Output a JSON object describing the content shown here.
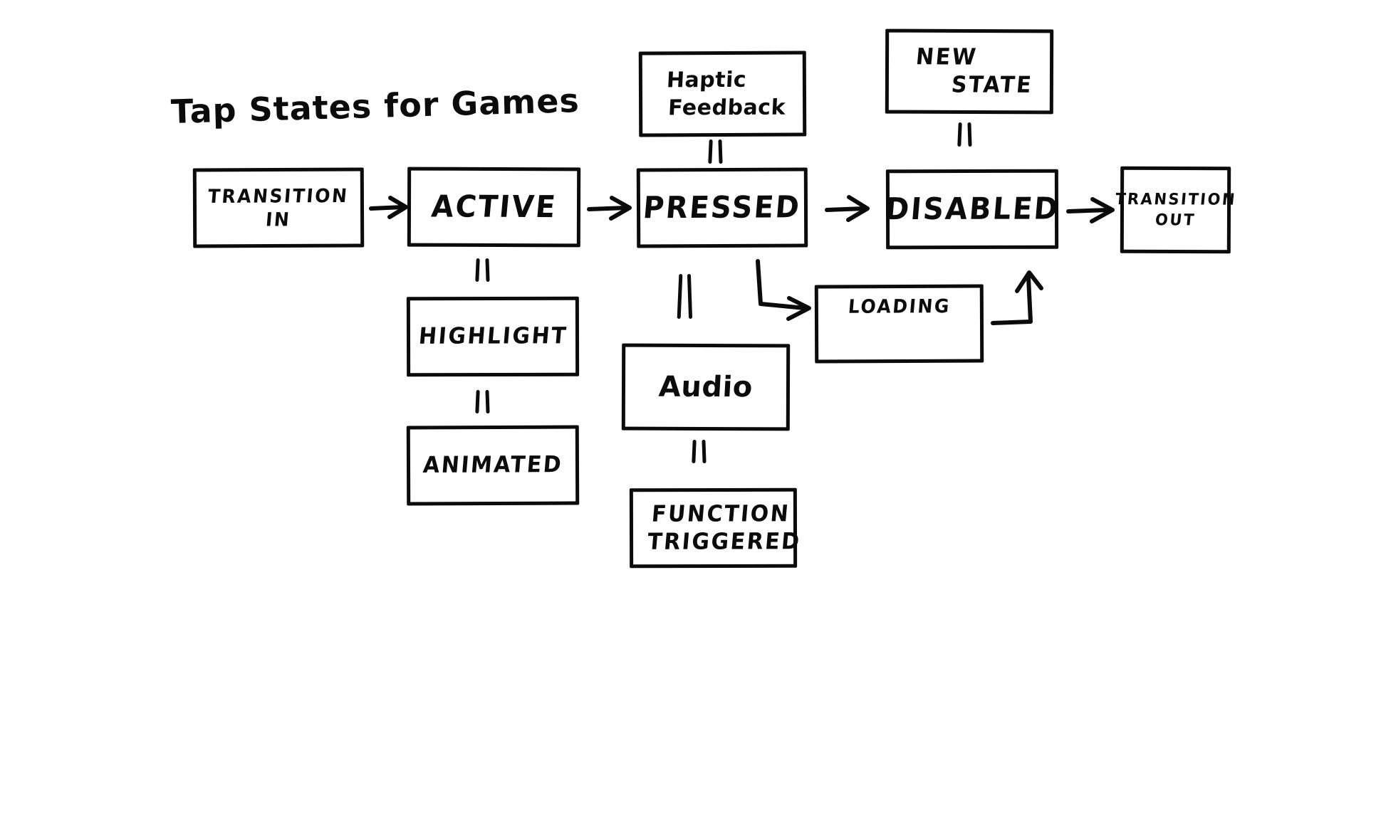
{
  "diagram": {
    "title": "Tap States for Games",
    "style": "hand-drawn whiteboard sketch",
    "ink_color": "#0b0b0b",
    "background_color": "#ffffff"
  },
  "nodes": {
    "transition_in": {
      "line1": "TRANSITION",
      "line2": "IN"
    },
    "active": {
      "line1": "ACTIVE"
    },
    "pressed": {
      "line1": "PRESSED"
    },
    "disabled": {
      "line1": "DISABLED"
    },
    "transition_out": {
      "line1": "TRANSITION",
      "line2": "OUT"
    },
    "haptic_feedback": {
      "line1": "Haptic",
      "line2": "Feedback"
    },
    "new_state": {
      "line1": "NEW",
      "line2": "STATE"
    },
    "highlight": {
      "line1": "HIGHLIGHT"
    },
    "animated": {
      "line1": "ANIMATED"
    },
    "audio": {
      "line1": "Audio"
    },
    "function_triggered": {
      "line1": "FUNCTION",
      "line2": "TRIGGERED"
    },
    "loading": {
      "line1": "LOADING",
      "icon": "spinner-icon"
    }
  },
  "connectors": {
    "arrow_transition_in_to_active": "arrow-right",
    "arrow_active_to_pressed": "arrow-right",
    "arrow_pressed_to_disabled": "arrow-right",
    "arrow_disabled_to_transition_out": "arrow-right",
    "elbow_pressed_to_loading": "elbow-arrow-down-right",
    "elbow_loading_to_disabled": "elbow-arrow-right-up",
    "pipes_haptic_to_pressed": "double-pipe",
    "pipes_new_state_to_disabled": "double-pipe",
    "pipes_active_to_highlight": "double-pipe",
    "pipes_highlight_to_animated": "double-pipe",
    "pipes_pressed_to_audio": "double-pipe",
    "pipes_audio_to_function_triggered": "double-pipe"
  }
}
